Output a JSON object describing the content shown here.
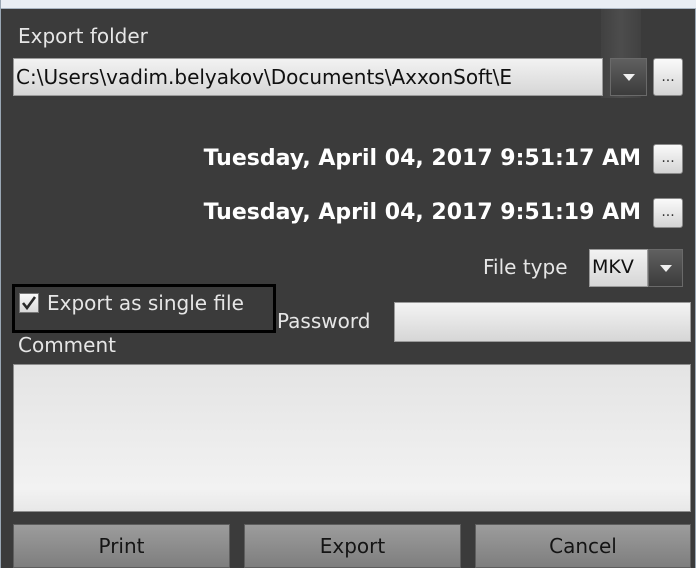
{
  "export_folder": {
    "label": "Export folder",
    "path": "C:\\Users\\vadim.belyakov\\Documents\\AxxonSoft\\E",
    "browse_label": "..."
  },
  "time_range": {
    "start": "Tuesday, April 04, 2017 9:51:17 AM",
    "end": "Tuesday, April 04, 2017 9:51:19 AM",
    "start_button": "...",
    "end_button": "..."
  },
  "file_type": {
    "label": "File type",
    "value": "MKV"
  },
  "export_single": {
    "label": "Export as single file",
    "checked": true
  },
  "password": {
    "label": "Password",
    "value": ""
  },
  "comment": {
    "label": "Comment",
    "value": ""
  },
  "buttons": {
    "print": "Print",
    "export": "Export",
    "cancel": "Cancel"
  },
  "colors": {
    "panel_bg": "#3b3b3b",
    "field_bg": "#e6e6e6",
    "button_bg": "#8c8c8c"
  }
}
